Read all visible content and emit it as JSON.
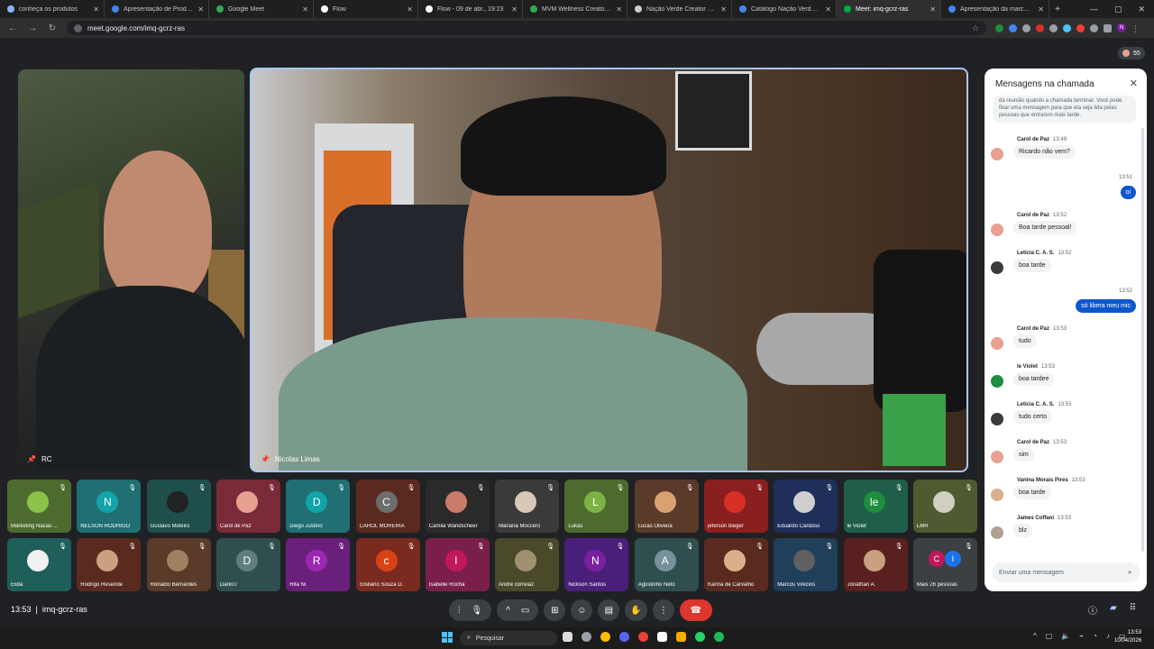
{
  "browser": {
    "tabs": [
      {
        "title": "conheça os produtos",
        "color": "#8ab4f8"
      },
      {
        "title": "Apresentação de Produtos da",
        "color": "#4285f4"
      },
      {
        "title": "Google Meet",
        "color": "#34a853"
      },
      {
        "title": "Flow",
        "color": "#ffffff"
      },
      {
        "title": "Flow - 09 de abr., 19:23",
        "color": "#ffffff"
      },
      {
        "title": "MVM Wellness Creators Hub",
        "color": "#34a853"
      },
      {
        "title": "Nação Verde Creator Milionário",
        "color": "#cccccc"
      },
      {
        "title": "Catálogo Nação Verde e estra",
        "color": "#4285f4"
      },
      {
        "title": "Meet: imq-gcrz-ras",
        "color": "#00ac47"
      },
      {
        "title": "Apresentação da marca e estr",
        "color": "#4285f4"
      }
    ],
    "url": "meet.google.com/imq-gcrz-ras",
    "participant_count": "55",
    "profile_initial": "N"
  },
  "main_tiles": {
    "left_name": "RC",
    "center_name": "Nicolas Limas"
  },
  "chat": {
    "title": "Mensagens na chamada",
    "note": "da reunião quando a chamada terminar. Você pode fixar uma mensagem para que ela seja lida pelas pessoas que entrarem mais tarde.",
    "input_placeholder": "Enviar uma mensagem",
    "messages": [
      {
        "who": "Carol de Paz",
        "time": "13:49",
        "text": "Ricardo não vem?",
        "me": false,
        "color": "#e8a090"
      },
      {
        "who": "",
        "time": "13:51",
        "text": "oi",
        "me": true,
        "color": ""
      },
      {
        "who": "Carol de Paz",
        "time": "13:52",
        "text": "Boa tarde pessoal!",
        "me": false,
        "color": "#e8a090"
      },
      {
        "who": "Letícia C. A. S.",
        "time": "13:52",
        "text": "boa tarde",
        "me": false,
        "color": "#3a3a3a"
      },
      {
        "who": "",
        "time": "13:52",
        "text": "só libera meu mic",
        "me": true,
        "color": ""
      },
      {
        "who": "Carol de Paz",
        "time": "13:53",
        "text": "tudo",
        "me": false,
        "color": "#e8a090"
      },
      {
        "who": "le Violet",
        "time": "13:53",
        "text": "boa tardee",
        "me": false,
        "color": "#1e8e3e"
      },
      {
        "who": "Letícia C. A. S.",
        "time": "13:53",
        "text": "tudo certo",
        "me": false,
        "color": "#3a3a3a"
      },
      {
        "who": "Carol de Paz",
        "time": "13:53",
        "text": "sim",
        "me": false,
        "color": "#e8a090"
      },
      {
        "who": "Vanina Morais Pires",
        "time": "13:53",
        "text": "boa tarde",
        "me": false,
        "color": "#d9b08c"
      },
      {
        "who": "James Coffani",
        "time": "13:53",
        "text": "blz",
        "me": false,
        "color": "#b0a090"
      }
    ]
  },
  "participants_row1": [
    {
      "name": "Marketing Nacao ...",
      "bg": "#4e6b2f",
      "ini": "",
      "pic": "#8bc34a"
    },
    {
      "name": "NELSON RODRIGO",
      "bg": "#1f6f73",
      "ini": "N",
      "pic": "#12a4a8"
    },
    {
      "name": "Gustavo Moleiro",
      "bg": "#1f4f4a",
      "ini": "",
      "pic": "#222"
    },
    {
      "name": "Carol de Paz",
      "bg": "#7a2a38",
      "ini": "",
      "pic": "#e8a090"
    },
    {
      "name": "Diego Justino",
      "bg": "#1f6f73",
      "ini": "D",
      "pic": "#12a4a8"
    },
    {
      "name": "CAROL MOREIRA",
      "bg": "#5a2a20",
      "ini": "C",
      "pic": "#6d6d6d"
    },
    {
      "name": "Camila Wandscheer",
      "bg": "#2a2a2a",
      "ini": "",
      "pic": "#c97b6a"
    },
    {
      "name": "Mariana Moccero",
      "bg": "#3a3a3a",
      "ini": "",
      "pic": "#d8c8b8"
    },
    {
      "name": "Lukas",
      "bg": "#4e6b2f",
      "ini": "L",
      "pic": "#7cb342"
    },
    {
      "name": "Lucas Oliveira",
      "bg": "#5a3a28",
      "ini": "",
      "pic": "#d9a070"
    },
    {
      "name": "jeferson bieger",
      "bg": "#8a1f1f",
      "ini": "",
      "pic": "#d93025"
    },
    {
      "name": "Eduardo Cardoso",
      "bg": "#1f2f5a",
      "ini": "",
      "pic": "#cfcfcf"
    },
    {
      "name": "le Violet",
      "bg": "#1f5f4a",
      "ini": "le",
      "pic": "#1e8e3e"
    },
    {
      "name": "LMR",
      "bg": "#4e5a2f",
      "ini": "",
      "pic": "#d0d0c0"
    }
  ],
  "participants_row2": [
    {
      "name": "Elida",
      "bg": "#1f5f5a",
      "ini": "",
      "pic": "#f0f0f0"
    },
    {
      "name": "Rodrigo Resende",
      "bg": "#5a2a1f",
      "ini": "",
      "pic": "#c9a080"
    },
    {
      "name": "Ronaldo Bernardes",
      "bg": "#5a3a28",
      "ini": "",
      "pic": "#a08060"
    },
    {
      "name": "Dark07",
      "bg": "#2f4f4f",
      "ini": "D",
      "pic": "#607d7d"
    },
    {
      "name": "Rita Ni",
      "bg": "#6a1f7a",
      "ini": "R",
      "pic": "#9c27b0"
    },
    {
      "name": "cristiano Souza D.",
      "bg": "#7a2a1f",
      "ini": "c",
      "pic": "#d84315"
    },
    {
      "name": "Isabelle Rocha",
      "bg": "#7a1f4a",
      "ini": "I",
      "pic": "#c2185b"
    },
    {
      "name": "André correiaz",
      "bg": "#4a4a2a",
      "ini": "",
      "pic": "#a09070"
    },
    {
      "name": "Nickson Santos",
      "bg": "#4a1f7a",
      "ini": "N",
      "pic": "#7b1fa2"
    },
    {
      "name": "Agostinho Neto",
      "bg": "#2f4f4f",
      "ini": "A",
      "pic": "#78909c"
    },
    {
      "name": "Karina de Carvalho",
      "bg": "#5a2a1f",
      "ini": "",
      "pic": "#d9b08c"
    },
    {
      "name": "Marcos Vinicios",
      "bg": "#1f3f5a",
      "ini": "",
      "pic": "#606060"
    },
    {
      "name": "Jonathan A.",
      "bg": "#5a1f1f",
      "ini": "",
      "pic": "#c9a080"
    },
    {
      "name": "Mais 26 pessoas",
      "bg": "#3c4043",
      "ini": "",
      "pic": ""
    }
  ],
  "bottom": {
    "time": "13:53",
    "meeting_code": "imq-gcrz-ras"
  },
  "taskbar": {
    "search": "Pesquisar",
    "clock_time": "13:53",
    "clock_date": "10/04/2026"
  }
}
